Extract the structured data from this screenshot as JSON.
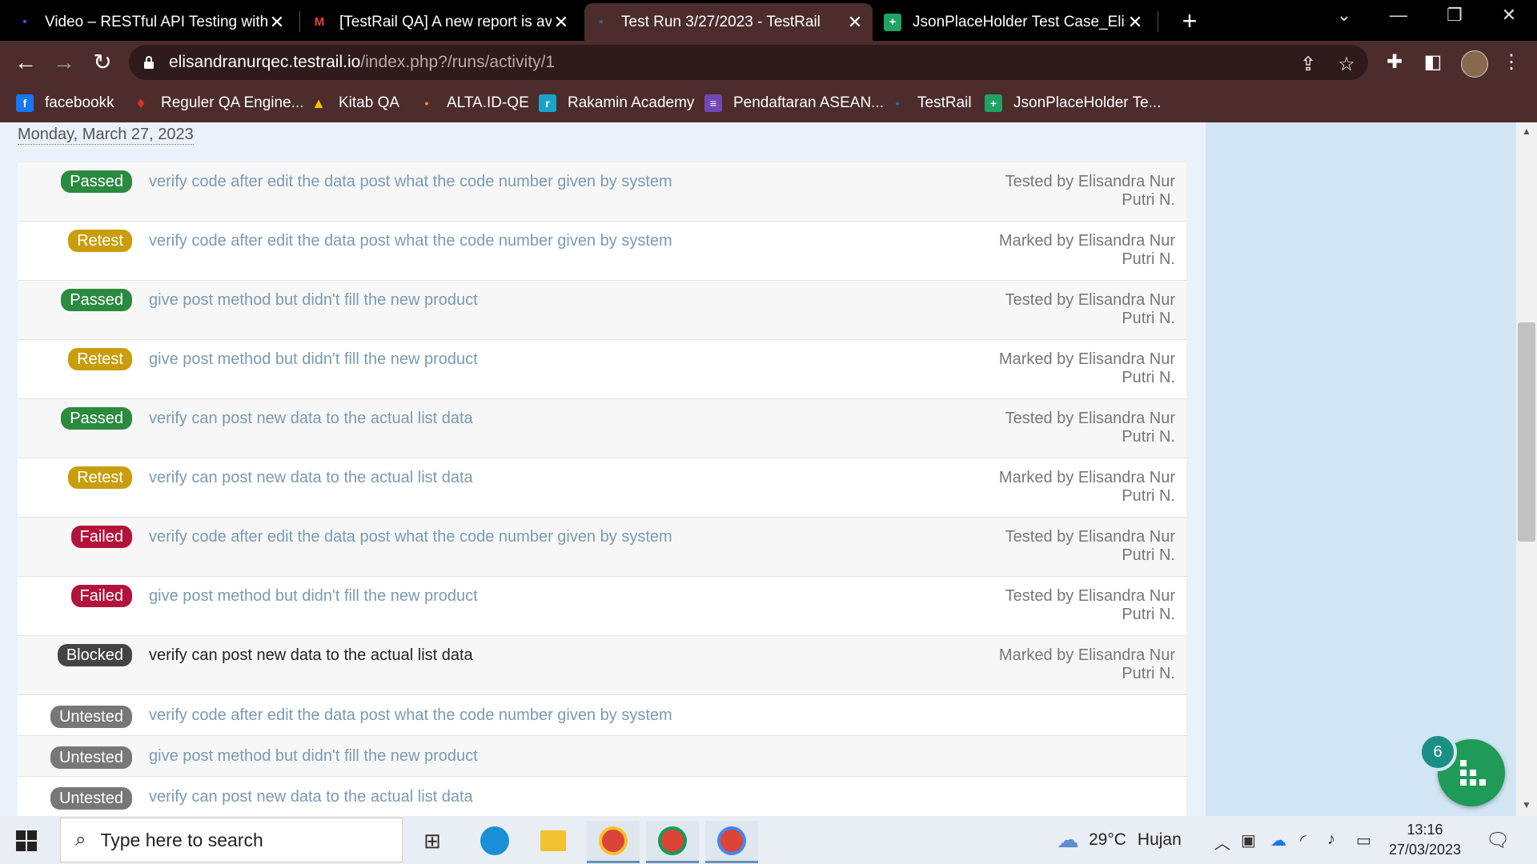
{
  "browser": {
    "tabs": [
      {
        "label": "Video – RESTful API Testing with P",
        "icon": "video-icon",
        "icon_color": "#3b5bdb"
      },
      {
        "label": "[TestRail QA] A new report is avai",
        "icon": "gmail-icon",
        "icon_color": "#ea4335"
      },
      {
        "label": "Test Run 3/27/2023 - TestRail",
        "icon": "testrail-icon",
        "icon_color": "#2d6cb5"
      },
      {
        "label": "JsonPlaceHolder Test Case_Elisan",
        "icon": "sheets-icon",
        "icon_color": "#1ea362"
      }
    ],
    "url_host": "elisandranurqec.testrail.io",
    "url_path": "/index.php?/runs/activity/1",
    "bookmarks": [
      {
        "label": "facebookk",
        "icon": "facebook-icon",
        "color": "#1877f2"
      },
      {
        "label": "Reguler QA Engine...",
        "icon": "drop-icon",
        "color": "#d93025"
      },
      {
        "label": "Kitab QA",
        "icon": "drive-icon",
        "color": "#fbbc04"
      },
      {
        "label": "ALTA.ID-QE",
        "icon": "alta-icon",
        "color": "#f28b30"
      },
      {
        "label": "Rakamin Academy",
        "icon": "rakamin-icon",
        "color": "#19a3c9"
      },
      {
        "label": "Pendaftaran ASEAN...",
        "icon": "forms-icon",
        "color": "#7248b9"
      },
      {
        "label": "TestRail",
        "icon": "testrail-icon",
        "color": "#2d6cb5"
      },
      {
        "label": "JsonPlaceHolder Te...",
        "icon": "sheets-icon",
        "color": "#1ea362"
      }
    ]
  },
  "page": {
    "date_heading": "Monday, March 27, 2023",
    "rows": [
      {
        "status": "Passed",
        "color": "#2b8a3e",
        "title": "verify code after edit the data post what the code number given by system",
        "by1": "Tested by Elisandra Nur",
        "by2": "Putri N."
      },
      {
        "status": "Retest",
        "color": "#c99d0c",
        "title": "verify code after edit the data post what the code number given by system",
        "by1": "Marked by Elisandra Nur",
        "by2": "Putri N."
      },
      {
        "status": "Passed",
        "color": "#2b8a3e",
        "title": "give post method but didn't fill the new product",
        "by1": "Tested by Elisandra Nur",
        "by2": "Putri N."
      },
      {
        "status": "Retest",
        "color": "#c99d0c",
        "title": "give post method but didn't fill the new product",
        "by1": "Marked by Elisandra Nur",
        "by2": "Putri N."
      },
      {
        "status": "Passed",
        "color": "#2b8a3e",
        "title": "verify can post new data to the actual list data",
        "by1": "Tested by Elisandra Nur",
        "by2": "Putri N."
      },
      {
        "status": "Retest",
        "color": "#c99d0c",
        "title": "verify can post new data to the actual list data",
        "by1": "Marked by Elisandra Nur",
        "by2": "Putri N."
      },
      {
        "status": "Failed",
        "color": "#b3123b",
        "title": "verify code after edit the data post what the code number given by system",
        "by1": "Tested by Elisandra Nur",
        "by2": "Putri N."
      },
      {
        "status": "Failed",
        "color": "#b3123b",
        "title": "give post method but didn't fill the new product",
        "by1": "Tested by Elisandra Nur",
        "by2": "Putri N."
      },
      {
        "status": "Blocked",
        "color": "#444444",
        "title": "verify can post new data to the actual list data",
        "by1": "Marked by Elisandra Nur",
        "by2": "Putri N."
      },
      {
        "status": "Untested",
        "color": "#777777",
        "title": "verify code after edit the data post what the code number given by system",
        "by1": "",
        "by2": ""
      },
      {
        "status": "Untested",
        "color": "#777777",
        "title": "give post method but didn't fill the new product",
        "by1": "",
        "by2": ""
      },
      {
        "status": "Untested",
        "color": "#777777",
        "title": "verify can post new data to the actual list data",
        "by1": "",
        "by2": ""
      }
    ],
    "fab_count": "6"
  },
  "taskbar": {
    "search_placeholder": "Type here to search",
    "weather_temp": "29°C",
    "weather_desc": "Hujan",
    "time": "13:16",
    "date": "27/03/2023"
  }
}
